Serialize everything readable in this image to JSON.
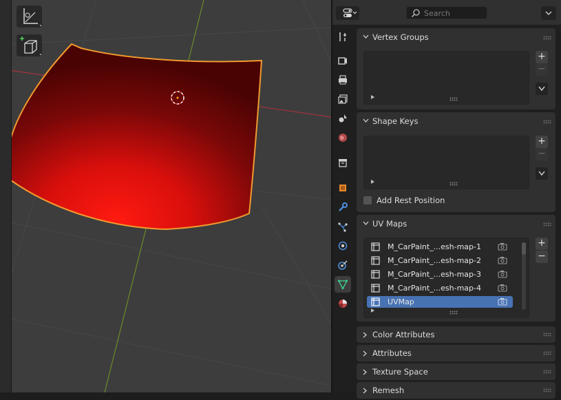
{
  "viewport": {
    "name": "3D Viewport",
    "object": "car paint mesh (selected)",
    "colors": {
      "background": "#3d3d3d",
      "mesh": "#d21010",
      "outline": "#f29a2e",
      "x_axis": "#a3343c",
      "y_axis": "#6c8b2b"
    }
  },
  "header": {
    "search_placeholder": "Search"
  },
  "tabs": [
    {
      "name": "tool",
      "icon": "wrench-screwdriver-icon"
    },
    {
      "name": "render",
      "icon": "camera-back-icon"
    },
    {
      "name": "output",
      "icon": "printer-icon"
    },
    {
      "name": "view-layer",
      "icon": "image-stack-icon"
    },
    {
      "name": "scene",
      "icon": "scene-icon"
    },
    {
      "name": "world",
      "icon": "globe-icon"
    },
    {
      "name": "collection",
      "icon": "box-icon"
    },
    {
      "name": "object",
      "icon": "object-square-icon"
    },
    {
      "name": "modifiers",
      "icon": "wrench-icon"
    },
    {
      "name": "particles",
      "icon": "particles-icon"
    },
    {
      "name": "physics",
      "icon": "physics-orbit-icon"
    },
    {
      "name": "constraints",
      "icon": "constraint-icon"
    },
    {
      "name": "data",
      "icon": "mesh-data-triangle-icon",
      "active": true
    },
    {
      "name": "material",
      "icon": "material-sphere-icon"
    }
  ],
  "panels": {
    "vertex_groups": {
      "title": "Vertex Groups"
    },
    "shape_keys": {
      "title": "Shape Keys",
      "add_rest_position_label": "Add Rest Position"
    },
    "uv_maps": {
      "title": "UV Maps",
      "items": [
        {
          "label": "M_CarPaint_...esh-map-1",
          "selected": false
        },
        {
          "label": "M_CarPaint_...esh-map-2",
          "selected": false
        },
        {
          "label": "M_CarPaint_...esh-map-3",
          "selected": false
        },
        {
          "label": "M_CarPaint_...esh-map-4",
          "selected": false
        },
        {
          "label": "UVMap",
          "selected": true
        }
      ]
    },
    "color_attributes": {
      "title": "Color Attributes"
    },
    "attributes": {
      "title": "Attributes"
    },
    "texture_space": {
      "title": "Texture Space"
    },
    "remesh": {
      "title": "Remesh"
    }
  },
  "buttons": {
    "add": "+",
    "remove": "−"
  }
}
